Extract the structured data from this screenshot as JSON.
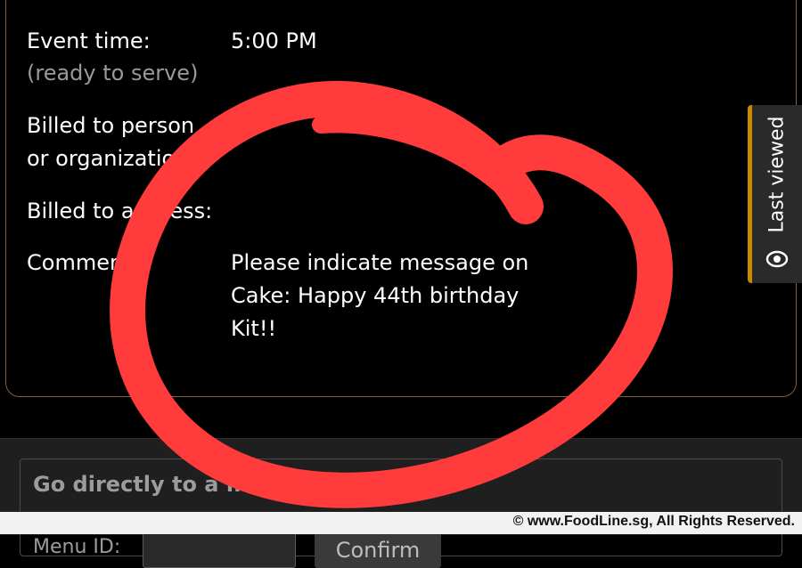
{
  "order_details": {
    "event_time_label": "Event time:",
    "event_time_sublabel": "(ready to serve)",
    "event_time_value": "5:00 PM",
    "billed_person_label_line1": "Billed to person",
    "billed_person_label_line2": "or organization:",
    "billed_address_label": "Billed to address:",
    "comments_label": "Comments:",
    "comments_line1": "Please indicate message on",
    "comments_line2": "Cake: Happy 44th birthday",
    "comments_line3": "Kit!!"
  },
  "menu_lookup": {
    "title": "Go directly to a m",
    "menu_id_label": "Menu ID:",
    "menu_id_value": "",
    "confirm_label": "Confirm"
  },
  "last_viewed": {
    "label": "Last viewed",
    "icon": "eye-icon",
    "accent_color": "#c98a00"
  },
  "annotation": {
    "color": "#ff3b3b",
    "shape": "hand-drawn-circle"
  },
  "footer": {
    "copyright": "© www.FoodLine.sg, All Rights Reserved."
  }
}
